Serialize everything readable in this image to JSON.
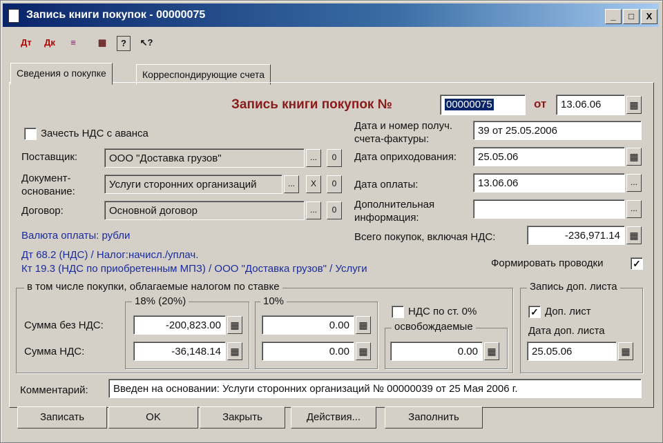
{
  "window": {
    "title": "Запись книги покупок - 00000075",
    "controls": [
      "_",
      "□",
      "X"
    ]
  },
  "toolbar": {
    "icons": [
      "new-doc-icon",
      "debit-credit-icon",
      "edit-entries-icon",
      "journal-icon",
      "help-icon",
      "pointer-help-icon"
    ],
    "glyphs": [
      "Дт",
      "Дк",
      "≡",
      "▦",
      "?",
      "↖?"
    ]
  },
  "tabs": [
    {
      "label": "Сведения о покупке",
      "active": true
    },
    {
      "label": "Корреспондирующие счета",
      "active": false
    }
  ],
  "header": {
    "title": "Запись книги покупок №",
    "number": "00000075",
    "from_label": "от",
    "date": "13.06.06"
  },
  "left": {
    "vat_advance_label": "Зачесть НДС с аванса",
    "supplier_label": "Поставщик:",
    "supplier_value": "ООО \"Доставка грузов\"",
    "basis_label": "Документ-основание:",
    "basis_value": "Услуги сторонних организаций",
    "contract_label": "Договор:",
    "contract_value": "Основной договор",
    "currency": "Валюта оплаты: рубли",
    "accounting_line1": "Дт 68.2 (НДС) / Налог:начисл./уплач.",
    "accounting_line2": "Кт 19.3 (НДС по приобретенным МПЗ) / ООО \"Доставка грузов\" / Услуги",
    "zero": "0",
    "x": "X"
  },
  "right": {
    "invoice_label": "Дата и номер получ. счета-фактуры:",
    "invoice_value": "39 от 25.05.2006",
    "posting_label": "Дата оприходования:",
    "posting_value": "25.05.06",
    "payment_label": "Дата оплаты:",
    "payment_value": "13.06.06",
    "extra_label": "Дополнительная информация:",
    "extra_value": "",
    "total_label": "Всего покупок, включая НДС:",
    "total_value": "-236,971.14",
    "form_entries_label": "Формировать проводки",
    "form_entries_checked": "✓"
  },
  "taxgroup": {
    "title": "в том числе покупки, облагаемые налогом по ставке",
    "rate18": "18% (20%)",
    "rate10": "10%",
    "vat0_label": "НДС по ст. 0%",
    "exempt_label": "освобождаемые",
    "sum_wo_vat_label": "Сумма без НДС:",
    "vat_sum_label": "Сумма НДС:",
    "r18_base": "-200,823.00",
    "r18_vat": "-36,148.14",
    "r10_base": "0.00",
    "r10_vat": "0.00",
    "exempt_value": "0.00"
  },
  "extrasheet": {
    "title": "Запись доп. листа",
    "checkbox_label": "Доп. лист",
    "checked": "✓",
    "date_label": "Дата доп. листа",
    "date_value": "25.05.06"
  },
  "comment": {
    "label": "Комментарий:",
    "value": "Введен на основании: Услуги сторонних организаций № 00000039 от 25 Мая 2006 г."
  },
  "buttons": {
    "write": "Записать",
    "ok": "OK",
    "close": "Закрыть",
    "actions": "Действия...",
    "fill": "Заполнить"
  }
}
